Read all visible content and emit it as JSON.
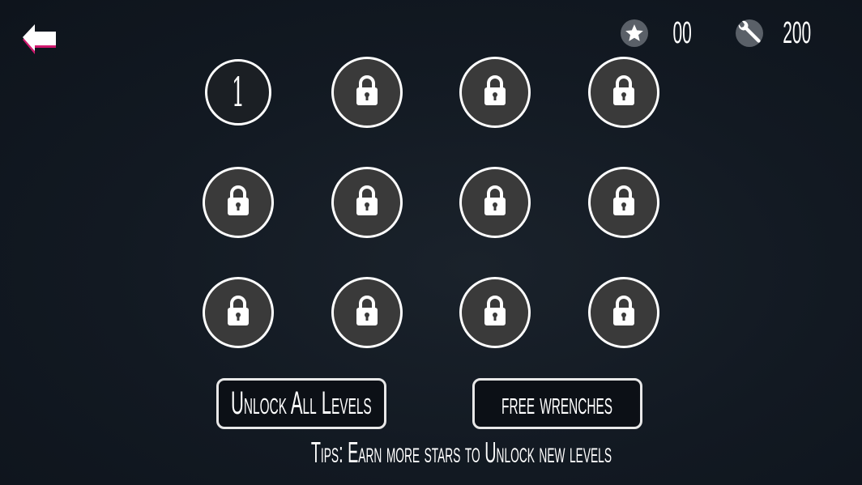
{
  "hud": {
    "stars": "00",
    "wrenches": "200",
    "star_icon": "star-icon",
    "wrench_icon": "wrench-icon"
  },
  "levels": [
    {
      "label": "1",
      "locked": false
    },
    {
      "locked": true
    },
    {
      "locked": true
    },
    {
      "locked": true
    },
    {
      "locked": true
    },
    {
      "locked": true
    },
    {
      "locked": true
    },
    {
      "locked": true
    },
    {
      "locked": true
    },
    {
      "locked": true
    },
    {
      "locked": true
    },
    {
      "locked": true
    }
  ],
  "buttons": {
    "unlock_all": "Unlock All Levels",
    "free_wrenches": "free wrenches"
  },
  "tips": "Tips: Earn more stars to Unlock new levels",
  "colors": {
    "background": "#121922",
    "locked_fill": "#3a3a3a",
    "back_arrow_shadow": "#d0186e"
  }
}
